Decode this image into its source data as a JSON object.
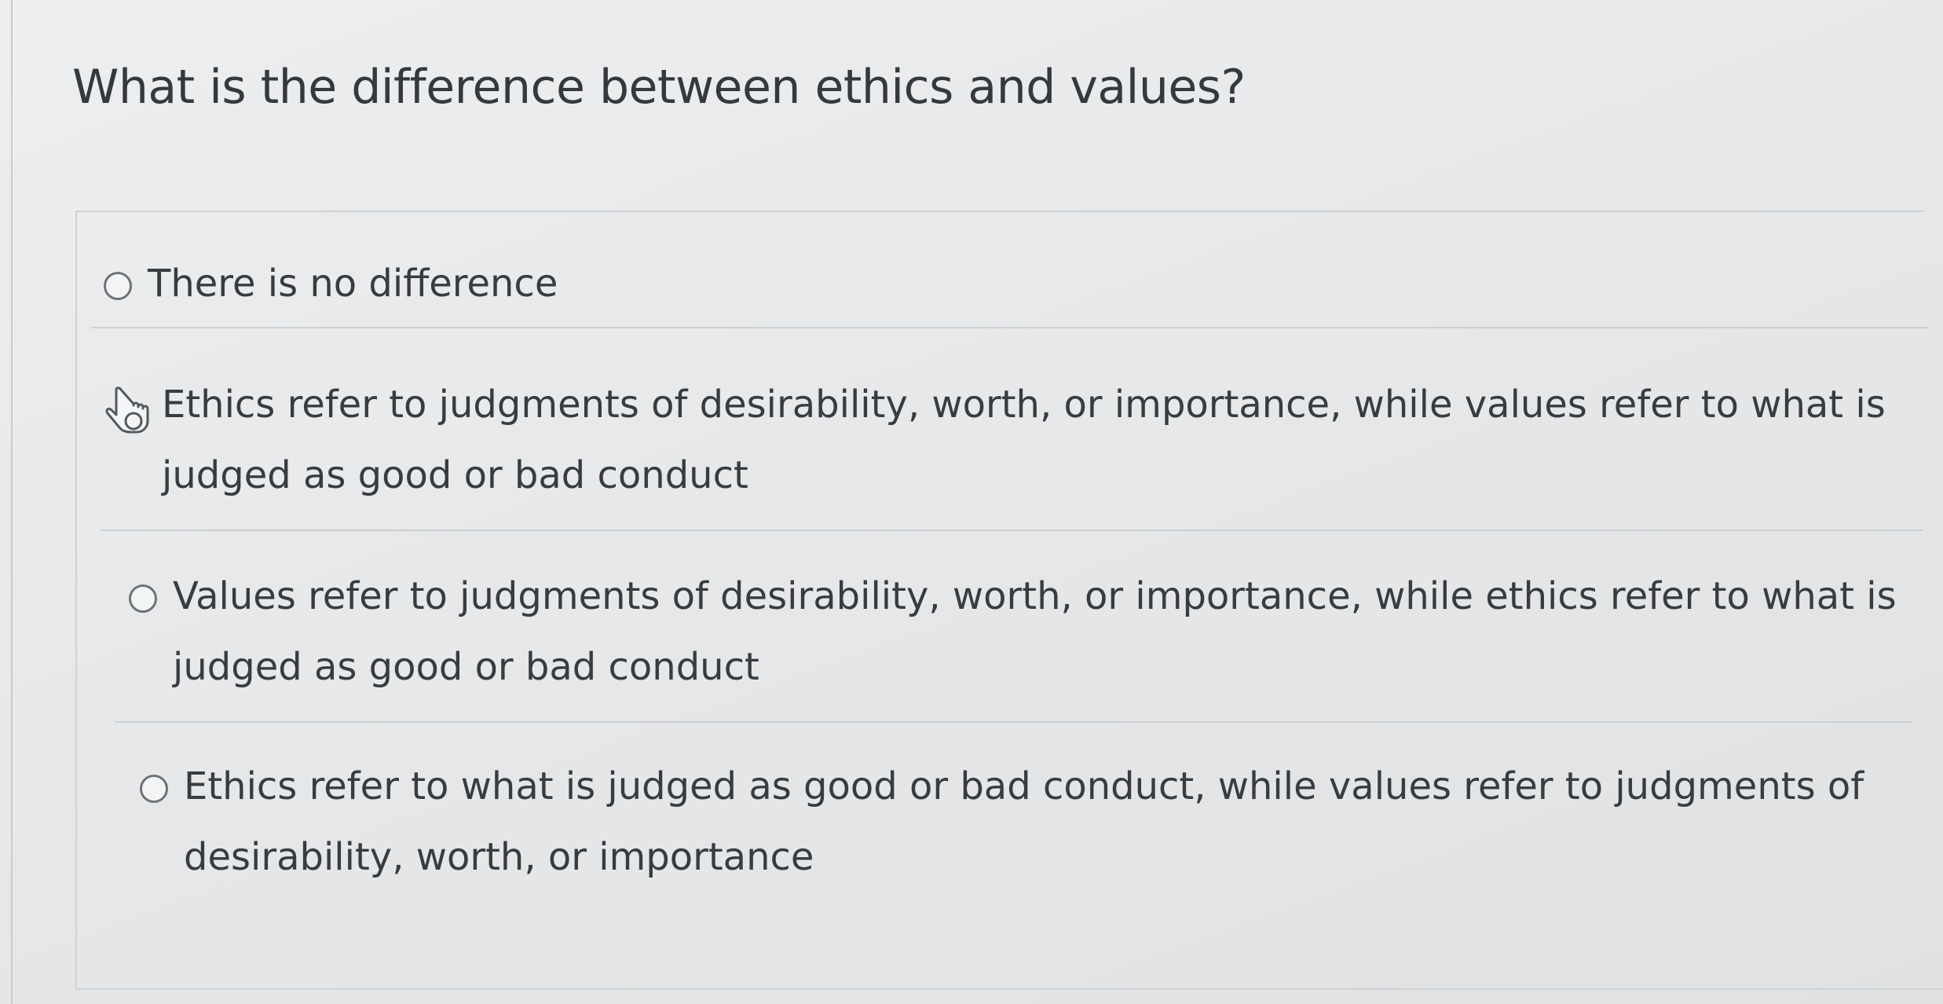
{
  "question": {
    "title": "What is the difference between ethics and values?"
  },
  "options": [
    {
      "label": "There is no difference",
      "selected": false
    },
    {
      "label": "Ethics refer to judgments of desirability, worth, or importance, while values refer to what is judged as good or bad conduct",
      "selected": false,
      "cursor_over": true
    },
    {
      "label": "Values refer to judgments of desirability, worth, or importance, while ethics refer to what is judged as good or bad conduct",
      "selected": false
    },
    {
      "label": "Ethics refer to what is judged as good or bad conduct, while values refer to judgments of desirability, worth, or importance",
      "selected": false
    }
  ],
  "icons": {
    "cursor": "hand-pointer-icon",
    "radio": "radio-button-icon"
  },
  "colors": {
    "background": "#e6e8ea",
    "text": "#383c3f",
    "divider": "#cdd0d2",
    "radio_border": "#6f7376"
  }
}
